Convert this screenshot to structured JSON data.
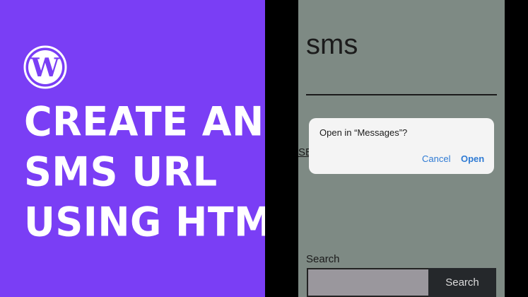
{
  "banner": {
    "logo_icon": "wordpress-icon",
    "headline_lines": [
      "CREATE AN",
      "SMS URL",
      "USING HTML"
    ],
    "background_color": "#7a3ef5"
  },
  "phone": {
    "site_title": "sms",
    "partial_link": "SE",
    "search": {
      "label": "Search",
      "input_value": "",
      "button_label": "Search"
    },
    "dialog": {
      "title": "Open in “Messages”?",
      "cancel_label": "Cancel",
      "open_label": "Open"
    },
    "screen_color": "#7e8a84"
  }
}
